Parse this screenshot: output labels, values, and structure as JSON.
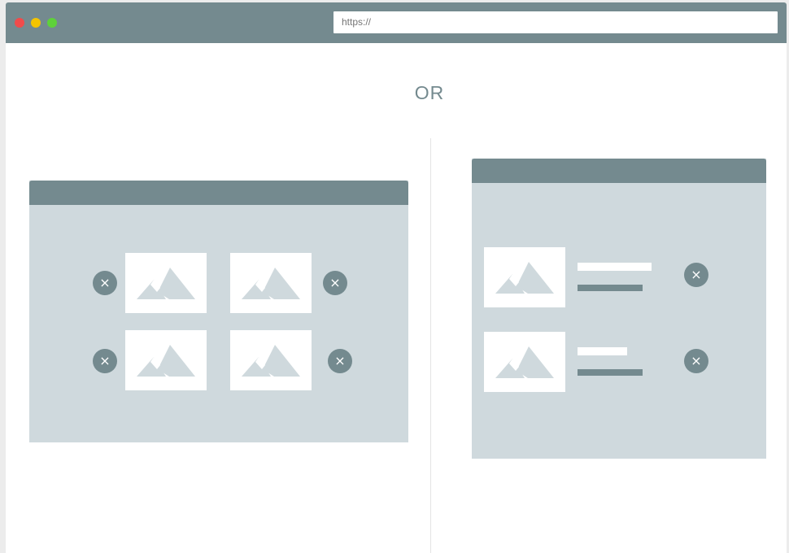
{
  "browser": {
    "url_placeholder": "https://",
    "window_controls": [
      "close",
      "minimize",
      "maximize"
    ]
  },
  "separator_text": "OR",
  "grid_option": {
    "items": [
      {
        "icon": "image-placeholder-icon",
        "remove_icon": "close-icon",
        "remove_label": "×"
      },
      {
        "icon": "image-placeholder-icon",
        "remove_icon": "close-icon",
        "remove_label": "×"
      },
      {
        "icon": "image-placeholder-icon",
        "remove_icon": "close-icon",
        "remove_label": "×"
      },
      {
        "icon": "image-placeholder-icon",
        "remove_icon": "close-icon",
        "remove_label": "×"
      }
    ]
  },
  "list_option": {
    "items": [
      {
        "icon": "image-placeholder-icon",
        "remove_icon": "close-icon",
        "remove_label": "×"
      },
      {
        "icon": "image-placeholder-icon",
        "remove_icon": "close-icon",
        "remove_label": "×"
      }
    ]
  },
  "colors": {
    "chrome": "#748a8f",
    "panel_bg": "#cfd9dd",
    "thumb_bg": "#ffffff",
    "mountain": "#cfd9dd",
    "close_red": "#f14b4b",
    "minimize_yellow": "#f4c400",
    "maximize_green": "#5ed13a"
  }
}
